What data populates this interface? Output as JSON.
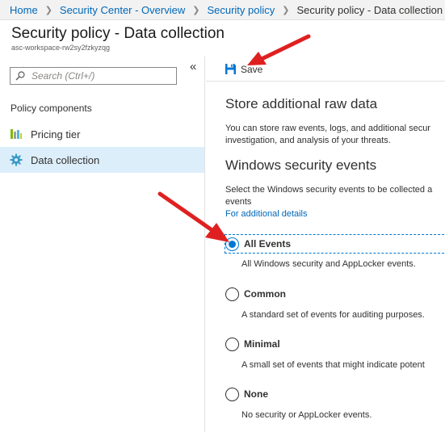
{
  "breadcrumb": {
    "items": [
      "Home",
      "Security Center - Overview",
      "Security policy"
    ],
    "current": "Security policy - Data collection"
  },
  "header": {
    "title": "Security policy - Data collection",
    "subtitle": "asc-workspace-rw2sy2fzkyzqg"
  },
  "sidebar": {
    "search_placeholder": "Search (Ctrl+/)",
    "collapse_icon": "«",
    "section_heading": "Policy components",
    "items": [
      {
        "label": "Pricing tier",
        "icon": "pricing-tier-icon",
        "active": false
      },
      {
        "label": "Data collection",
        "icon": "gear-icon",
        "active": true
      }
    ]
  },
  "toolbar": {
    "save_label": "Save",
    "save_icon": "floppy-disk-icon"
  },
  "raw_data": {
    "heading": "Store additional raw data",
    "line1": "You can store raw events, logs, and additional secur",
    "line2": "investigation, and analysis of your threats."
  },
  "windows_events": {
    "heading": "Windows security events",
    "line1": "Select the Windows security events to be collected a",
    "line2": "events",
    "link": "For additional details",
    "selected": "All Events",
    "options": [
      {
        "label": "All Events",
        "description": "All Windows security and AppLocker events.",
        "checked": true
      },
      {
        "label": "Common",
        "description": "A standard set of events for auditing purposes.",
        "checked": false
      },
      {
        "label": "Minimal",
        "description": "A small set of events that might indicate potent",
        "checked": false
      },
      {
        "label": "None",
        "description": "No security or AppLocker events.",
        "checked": false
      }
    ]
  },
  "colors": {
    "accent": "#0078d4",
    "link": "#0067b8",
    "active_nav": "#ddeefb",
    "annotation_arrow": "#e02020"
  }
}
